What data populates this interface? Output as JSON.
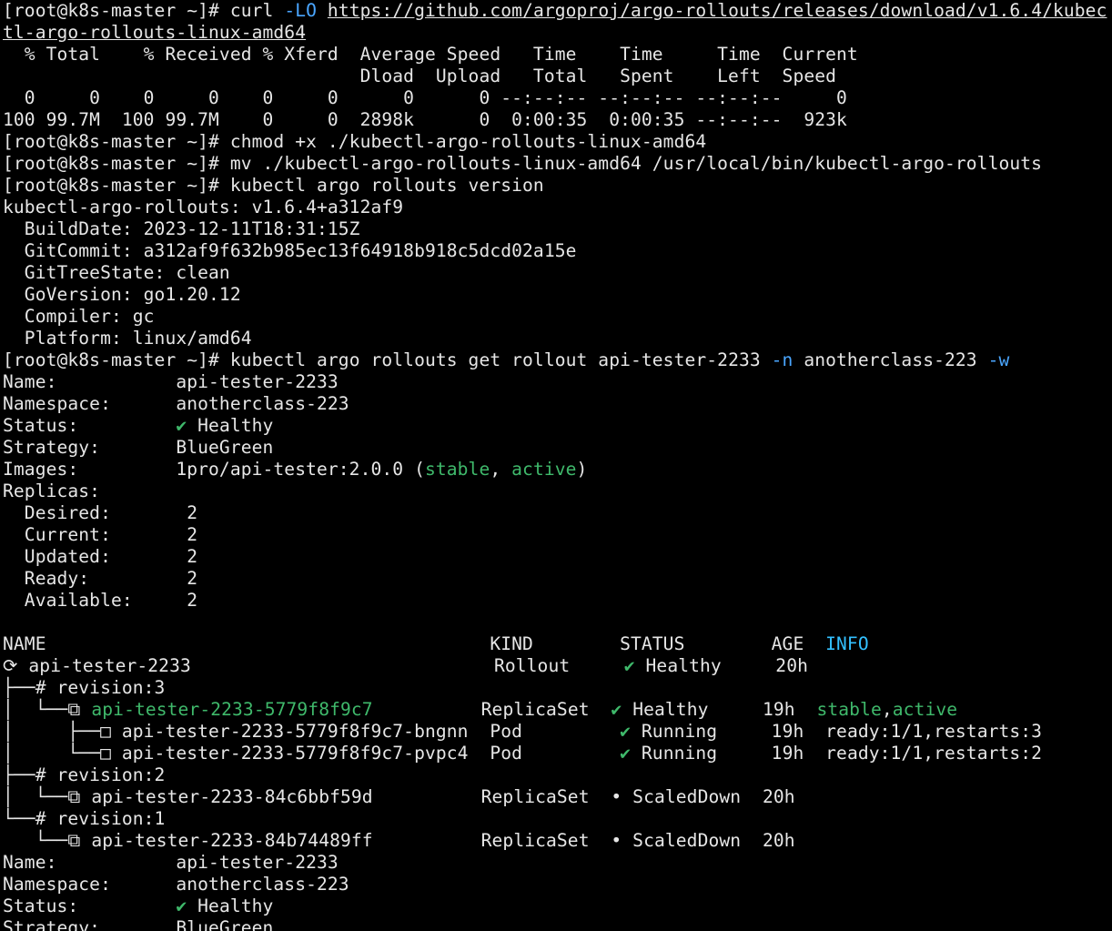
{
  "prompt": "[root@k8s-master ~]# ",
  "curl": {
    "cmd": "curl ",
    "flag": "-LO",
    "url_part1": "https://github.com/argoproj/argo-rollouts/releases/download/v1.6.4/kubec",
    "url_part2": "tl-argo-rollouts-linux-amd64"
  },
  "progress": {
    "header1": "  % Total    % Received % Xferd  Average Speed   Time    Time     Time  Current",
    "header2": "                                 Dload  Upload   Total   Spent    Left  Speed",
    "row1": "  0     0    0     0    0     0      0      0 --:--:-- --:--:-- --:--:--     0",
    "row2": "100 99.7M  100 99.7M    0     0  2898k      0  0:00:35  0:00:35 --:--:--  923k"
  },
  "cmds": {
    "chmod": "chmod +x ./kubectl-argo-rollouts-linux-amd64",
    "mv": "mv ./kubectl-argo-rollouts-linux-amd64 /usr/local/bin/kubectl-argo-rollouts",
    "version": "kubectl argo rollouts version",
    "get": "kubectl argo rollouts get rollout api-tester-2233 ",
    "get_n_flag": "-n",
    "get_ns": " anotherclass-223 ",
    "get_w_flag": "-w"
  },
  "version_info": {
    "line1": "kubectl-argo-rollouts: v1.6.4+a312af9",
    "line2": "  BuildDate: 2023-12-11T18:31:15Z",
    "line3": "  GitCommit: a312af9f632b985ec13f64918b918c5dcd02a15e",
    "line4": "  GitTreeState: clean",
    "line5": "  GoVersion: go1.20.12",
    "line6": "  Compiler: gc",
    "line7": "  Platform: linux/amd64"
  },
  "rollout": {
    "name_label": "Name:           ",
    "name_value": "api-tester-2233",
    "ns_label": "Namespace:      ",
    "ns_value": "anotherclass-223",
    "status_label": "Status:         ",
    "check": "✔",
    "status_value": " Healthy",
    "strategy_label": "Strategy:       ",
    "strategy_value": "BlueGreen",
    "images_label": "Images:         ",
    "images_value": "1pro/api-tester:2.0.0 (",
    "images_stable": "stable",
    "images_sep": ", ",
    "images_active": "active",
    "images_close": ")",
    "replicas_label": "Replicas:",
    "desired": "  Desired:       2",
    "current": "  Current:       2",
    "updated": "  Updated:       2",
    "ready": "  Ready:         2",
    "available": "  Available:     2"
  },
  "tree": {
    "header_main": "NAME                                         KIND        STATUS        AGE  ",
    "header_info": "INFO",
    "rows": [
      {
        "prefix": "⟳ api-tester-2233                            ",
        "rest": "Rollout     ",
        "check": "✔",
        "status": " Healthy     20h",
        "info": ""
      },
      {
        "prefix": "├──# revision:3",
        "rest": "",
        "check": "",
        "status": "",
        "info": ""
      },
      {
        "prefix": "│  └──⧉ ",
        "name_green": "api-tester-2233-5779f8f9c7",
        "pad": "          ",
        "rest": "ReplicaSet  ",
        "check": "✔",
        "status": " Healthy     19h  ",
        "info_stable": "stable",
        "info_sep": ",",
        "info_active": "active"
      },
      {
        "prefix": "│     ├──□ api-tester-2233-5779f8f9c7-bngnn  Pod         ",
        "check": "✔",
        "status": " Running     19h  ready:1/1,restarts:3"
      },
      {
        "prefix": "│     └──□ api-tester-2233-5779f8f9c7-pvpc4  Pod         ",
        "check": "✔",
        "status": " Running     19h  ready:1/1,restarts:2"
      },
      {
        "prefix": "├──# revision:2"
      },
      {
        "prefix": "│  └──⧉ api-tester-2233-84c6bbf59d          ReplicaSet  • ScaledDown  20h"
      },
      {
        "prefix": "└──# revision:1"
      },
      {
        "prefix": "   └──⧉ api-tester-2233-84b74489ff          ReplicaSet  • ScaledDown  20h"
      }
    ]
  },
  "rollout2": {
    "name": "Name:           api-tester-2233",
    "ns": "Namespace:      anotherclass-223",
    "status_label": "Status:         ",
    "check": "✔",
    "status_value": " Healthy",
    "strategy": "Strategy:       BlueGreen"
  },
  "colors": {
    "background": "#000000",
    "foreground": "#e6e6e6",
    "green": "#3fb96b",
    "cyan": "#33c0ff",
    "flag_blue": "#4aa6ff"
  }
}
